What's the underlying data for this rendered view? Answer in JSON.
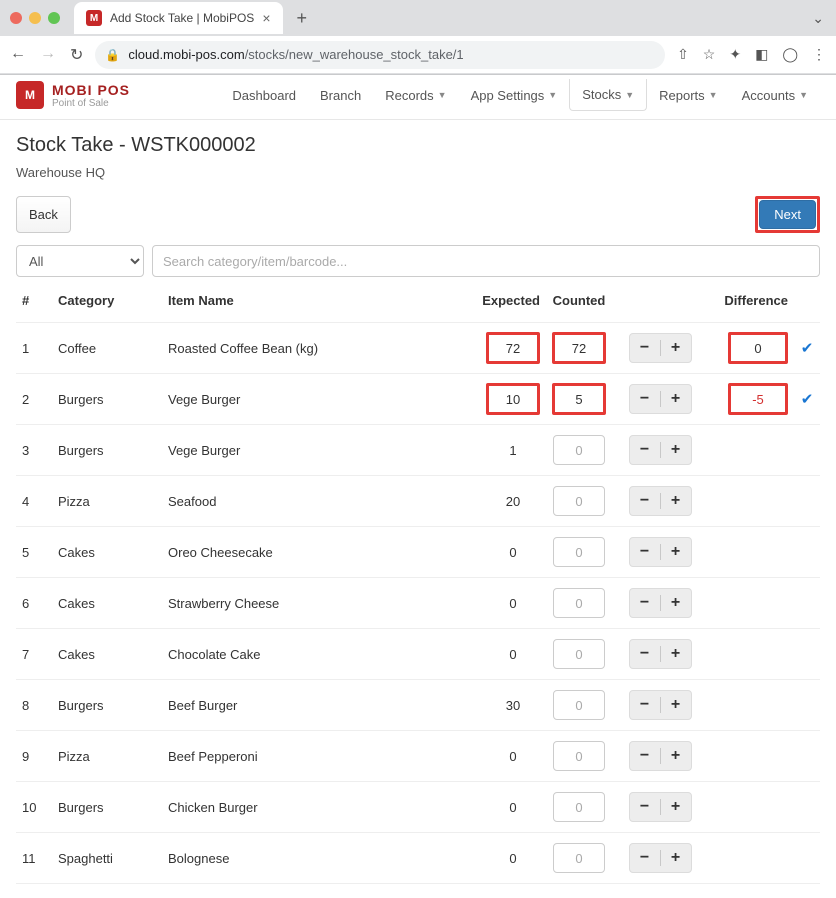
{
  "browser": {
    "tab_title": "Add Stock Take | MobiPOS",
    "url_host": "cloud.mobi-pos.com",
    "url_path": "/stocks/new_warehouse_stock_take/1"
  },
  "brand": {
    "title": "MOBI POS",
    "subtitle": "Point of Sale"
  },
  "nav": {
    "dashboard": "Dashboard",
    "branch": "Branch",
    "records": "Records",
    "app_settings": "App Settings",
    "stocks": "Stocks",
    "reports": "Reports",
    "accounts": "Accounts"
  },
  "page": {
    "title": "Stock Take - WSTK000002",
    "subtitle": "Warehouse HQ",
    "back": "Back",
    "next": "Next"
  },
  "filters": {
    "category_all": "All",
    "search_placeholder": "Search category/item/barcode..."
  },
  "table": {
    "headers": {
      "num": "#",
      "category": "Category",
      "item": "Item Name",
      "expected": "Expected",
      "counted": "Counted",
      "difference": "Difference"
    },
    "rows": [
      {
        "n": "1",
        "cat": "Coffee",
        "item": "Roasted Coffee Bean (kg)",
        "exp": "72",
        "cnt": "72",
        "diff": "0",
        "hl": true,
        "neg": false,
        "checked": true
      },
      {
        "n": "2",
        "cat": "Burgers",
        "item": "Vege Burger",
        "exp": "10",
        "cnt": "5",
        "diff": "-5",
        "hl": true,
        "neg": true,
        "checked": true
      },
      {
        "n": "3",
        "cat": "Burgers",
        "item": "Vege Burger",
        "exp": "1",
        "cnt": "",
        "diff": "",
        "hl": false
      },
      {
        "n": "4",
        "cat": "Pizza",
        "item": "Seafood",
        "exp": "20",
        "cnt": "",
        "diff": "",
        "hl": false
      },
      {
        "n": "5",
        "cat": "Cakes",
        "item": "Oreo Cheesecake",
        "exp": "0",
        "cnt": "",
        "diff": "",
        "hl": false
      },
      {
        "n": "6",
        "cat": "Cakes",
        "item": "Strawberry Cheese",
        "exp": "0",
        "cnt": "",
        "diff": "",
        "hl": false
      },
      {
        "n": "7",
        "cat": "Cakes",
        "item": "Chocolate Cake",
        "exp": "0",
        "cnt": "",
        "diff": "",
        "hl": false
      },
      {
        "n": "8",
        "cat": "Burgers",
        "item": "Beef Burger",
        "exp": "30",
        "cnt": "",
        "diff": "",
        "hl": false
      },
      {
        "n": "9",
        "cat": "Pizza",
        "item": "Beef Pepperoni",
        "exp": "0",
        "cnt": "",
        "diff": "",
        "hl": false
      },
      {
        "n": "10",
        "cat": "Burgers",
        "item": "Chicken Burger",
        "exp": "0",
        "cnt": "",
        "diff": "",
        "hl": false
      },
      {
        "n": "11",
        "cat": "Spaghetti",
        "item": "Bolognese",
        "exp": "0",
        "cnt": "",
        "diff": "",
        "hl": false
      }
    ]
  }
}
